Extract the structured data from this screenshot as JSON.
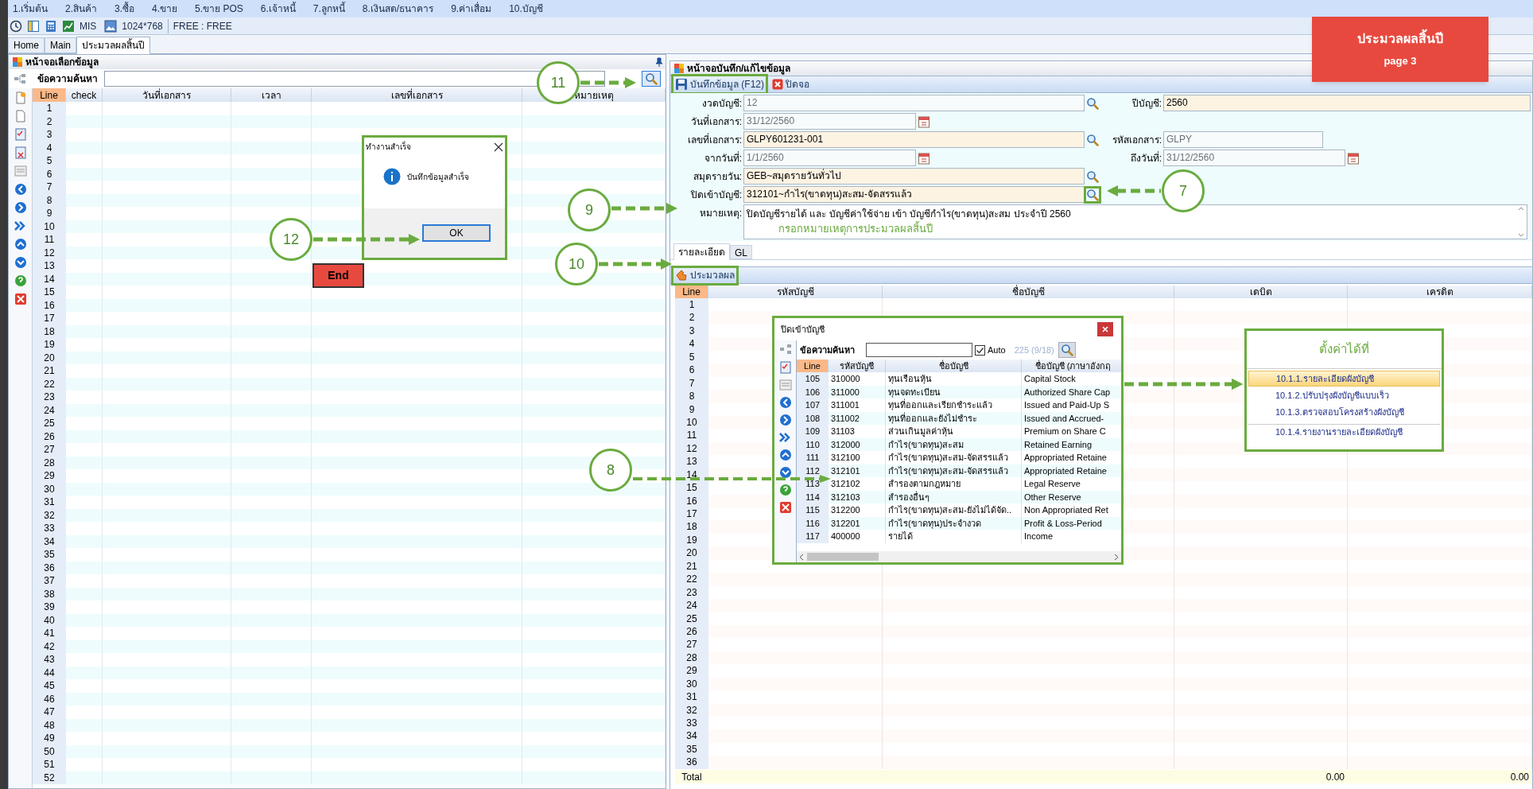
{
  "menu": [
    "1.เริ่มต้น",
    "2.สินค้า",
    "3.ซื้อ",
    "4.ขาย",
    "5.ขาย POS",
    "6.เจ้าหนี้",
    "7.ลูกหนี้",
    "8.เงินสด/ธนาคาร",
    "9.ค่าเสื่อม",
    "10.บัญชี"
  ],
  "toolbar": {
    "mis": "MIS",
    "resolution": "1024*768",
    "license": "FREE : FREE"
  },
  "tabs": [
    {
      "label": "Home",
      "selected": false
    },
    {
      "label": "Main",
      "selected": false
    },
    {
      "label": "ประมวลผลสิ้นปี",
      "selected": true
    }
  ],
  "left_panel": {
    "title": "หน้าจอเลือกข้อมูล",
    "search_label": "ข้อความค้นหา",
    "columns": [
      "Line",
      "check",
      "วันที่เอกสาร",
      "เวลา",
      "เลขที่เอกสาร",
      "หมายเหตุ"
    ],
    "lines": [
      "1",
      "2",
      "3",
      "4",
      "5",
      "6",
      "7",
      "8",
      "9",
      "10",
      "11",
      "12",
      "13",
      "14",
      "15",
      "16",
      "17",
      "18",
      "19",
      "20",
      "21",
      "22",
      "23",
      "24",
      "25",
      "26",
      "27",
      "28",
      "29",
      "30",
      "31",
      "32",
      "33",
      "34",
      "35",
      "36",
      "37",
      "38",
      "39",
      "40",
      "41",
      "42",
      "43",
      "44",
      "45",
      "46",
      "47",
      "48",
      "49",
      "50",
      "51",
      "52"
    ]
  },
  "right_panel": {
    "title": "หน้าจอบันทึก/แก้ไขข้อมูล",
    "actions": [
      {
        "label": "บันทึกข้อมูล (F12)",
        "kind": "save"
      },
      {
        "label": "ปิดจอ",
        "kind": "close"
      }
    ],
    "form": [
      [
        {
          "label": "งวดบัญชี:",
          "value": "12",
          "kind": "search",
          "disabled": true
        },
        {
          "label": "ปีบัญชี:",
          "value": "2560",
          "kind": "text",
          "disabled": false
        }
      ],
      [
        {
          "label": "วันที่เอกสาร:",
          "value": "31/12/2560",
          "kind": "date",
          "disabled": true
        }
      ],
      [
        {
          "label": "เลขที่เอกสาร:",
          "value": "GLPY601231-001",
          "kind": "search",
          "disabled": false
        },
        {
          "label": "รหัสเอกสาร:",
          "value": "GLPY",
          "kind": "text",
          "disabled": true
        }
      ],
      [
        {
          "label": "จากวันที่:",
          "value": "1/1/2560",
          "kind": "date",
          "disabled": true
        },
        {
          "label": "ถึงวันที่:",
          "value": "31/12/2560",
          "kind": "date",
          "disabled": true
        }
      ],
      [
        {
          "label": "สมุดรายวัน:",
          "value": "GEB~สมุดรายวันทั่วไป",
          "kind": "search",
          "disabled": false
        }
      ],
      [
        {
          "label": "ปิดเข้าบัญชี:",
          "value": "312101~กำไร(ขาดทุน)สะสม-จัดสรรแล้ว",
          "kind": "search",
          "disabled": false
        }
      ]
    ],
    "note": {
      "label": "หมายเหตุ:",
      "value": "ปิดบัญชีรายได้ และ บัญชีค่าใช้จ่าย เข้า บัญชีกำไร(ขาดทุน)สะสม ประจำปี 2560"
    },
    "detail_tabs": [
      {
        "label": "รายละเอียด",
        "selected": true
      },
      {
        "label": "GL",
        "selected": false
      }
    ],
    "process_button": "ประมวลผล",
    "columns": [
      "Line",
      "รหัสบัญชี",
      "ชื่อบัญชี",
      "เดบิต",
      "เครดิต"
    ],
    "lines": [
      "1",
      "2",
      "3",
      "4",
      "5",
      "6",
      "7",
      "8",
      "9",
      "10",
      "11",
      "12",
      "13",
      "14",
      "15",
      "16",
      "17",
      "18",
      "19",
      "20",
      "21",
      "22",
      "23",
      "24",
      "25",
      "26",
      "27",
      "28",
      "29",
      "30",
      "31",
      "32",
      "33",
      "34",
      "35",
      "36"
    ],
    "total": {
      "label": "Total",
      "debit": "0.00",
      "credit": "0.00"
    }
  },
  "account_dialog": {
    "title": "ปิดเข้าบัญชี",
    "search_label": "ข้อความค้นหา",
    "auto_checked": true,
    "auto_label": "Auto",
    "count": "225 (9/18)",
    "columns": [
      "Line",
      "รหัสบัญชี",
      "ชื่อบัญชี",
      "ชื่อบัญชี (ภาษาอังกฤ"
    ],
    "rows": [
      [
        "105",
        "310000",
        "ทุนเรือนหุ้น",
        "Capital Stock"
      ],
      [
        "106",
        "311000",
        "ทุนจดทะเบียน",
        "Authorized Share Cap"
      ],
      [
        "107",
        "311001",
        "ทุนที่ออกและเรียกชำระแล้ว",
        "Issued and Paid-Up S"
      ],
      [
        "108",
        "311002",
        "ทุนที่ออกและยังไม่ชำระ",
        "Issued and Accrued-"
      ],
      [
        "109",
        "31103",
        "ส่วนเกินมูลค่าหุ้น",
        "Premium on Share C"
      ],
      [
        "110",
        "312000",
        "กำไร(ขาดทุน)สะสม",
        "Retained Earning"
      ],
      [
        "111",
        "312100",
        "กำไร(ขาดทุน)สะสม-จัดสรรแล้ว",
        "Appropriated Retaine"
      ],
      [
        "112",
        "312101",
        "กำไร(ขาดทุน)สะสม-จัดสรรแล้ว",
        "Appropriated Retaine"
      ],
      [
        "113",
        "312102",
        "สำรองตามกฎหมาย",
        "Legal Reserve"
      ],
      [
        "114",
        "312103",
        "สำรองอื่นๆ",
        "Other Reserve"
      ],
      [
        "115",
        "312200",
        "กำไร(ขาดทุน)สะสม-ยังไม่ได้จัด..",
        "Non Appropriated Ret"
      ],
      [
        "116",
        "312201",
        "กำไร(ขาดทุน)ประจำงวด",
        "Profit & Loss-Period"
      ],
      [
        "117",
        "400000",
        "รายได้",
        "Income"
      ]
    ]
  },
  "message_box": {
    "title": "ทำงานสำเร็จ",
    "message": "บันทึกข้อมูลสำเร็จ",
    "button": "OK"
  },
  "settings_menu": {
    "title": "ตั้งค่าได้ที่",
    "items": [
      {
        "label": "10.1.1.รายละเอียดผังบัญชี",
        "selected": true
      },
      {
        "label": "10.1.2.ปรับปรุงผังบัญชีแบบเร็ว",
        "selected": false
      },
      {
        "label": "10.1.3.ตรวจสอบโครงสร้างผังบัญชี",
        "selected": false
      },
      {
        "label": "10.1.4.รายงานรายละเอียดผังบัญชี",
        "selected": false
      }
    ]
  },
  "banner": {
    "title": "ประมวลผลสิ้นปี",
    "subtitle": "page 3"
  },
  "note_hint": "กรอกหมายเหตุการประมวลผลสิ้นปี",
  "end_label": "End",
  "callouts": [
    "11",
    "7",
    "9",
    "10",
    "8",
    "12"
  ]
}
